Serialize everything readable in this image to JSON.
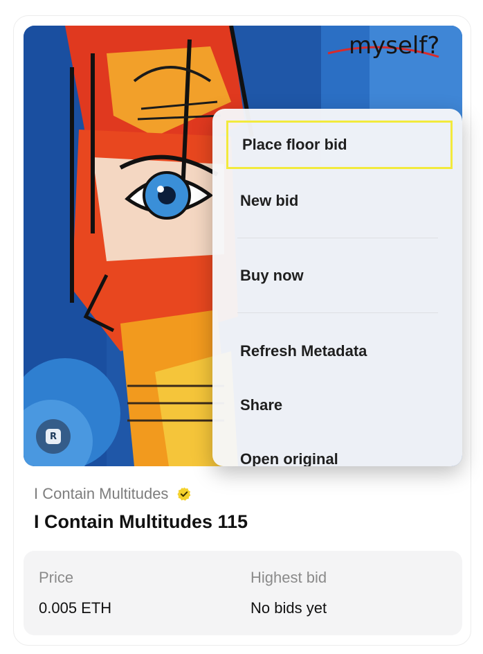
{
  "menu": {
    "items": [
      {
        "label": "Place floor bid"
      },
      {
        "label": "New bid"
      },
      {
        "label": "Buy now"
      },
      {
        "label": "Refresh Metadata"
      },
      {
        "label": "Share"
      },
      {
        "label": "Open original"
      }
    ],
    "focused_item": "Place floor bid",
    "focus_color": "#f2ea3c"
  },
  "artwork": {
    "painted_text": "myself?",
    "badge_icon": "rarible-r-icon",
    "badge_letter": "R"
  },
  "collection": {
    "name": "I Contain Multitudes",
    "verified_icon": "verified-badge-icon",
    "verified_color": "#f4d12c"
  },
  "item": {
    "title": "I Contain Multitudes 115"
  },
  "stats": {
    "price_label": "Price",
    "price_value": "0.005 ETH",
    "highest_bid_label": "Highest bid",
    "highest_bid_value": "No bids yet"
  }
}
